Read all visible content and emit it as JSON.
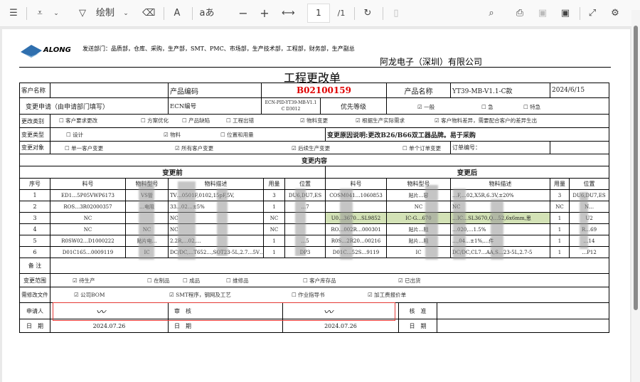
{
  "toolbar": {
    "draw_label": "绘制",
    "read_aloud": "A",
    "text_icon": "aあ",
    "zoom_out": "−",
    "zoom_in": "+",
    "page_current": "1",
    "page_total": "/1"
  },
  "doc": {
    "send_depts": "发送部门：品质部，仓库、采购，生产部，SMT、PMC、市场部，生产技术部，工程部，财务部，生产副总",
    "logo_text": "ALONG",
    "company": "阿龙电子（深圳）有限公司",
    "title": "工程更改单",
    "customer_label": "客户名称",
    "customer_value": "",
    "product_code_label": "产品编码",
    "product_code": "B02100159",
    "product_name_label": "产品名称",
    "product_name": "YT39-MB-V1.1-C款",
    "date": "2024/6/15",
    "request_label": "变更申请（由申请部门填写）",
    "ecn_label": "ECN编号",
    "ecn_value": "ECN-PID-YT39-MB-V1.1 C D3012",
    "priority_label": "优先等级",
    "priority": [
      {
        "label": "一般",
        "checked": true
      },
      {
        "label": "急",
        "checked": false
      },
      {
        "label": "特急",
        "checked": false
      }
    ],
    "change_category_label": "更改类别",
    "change_category": [
      {
        "label": "客户要求更改",
        "checked": false
      },
      {
        "label": "方案优化",
        "checked": false
      },
      {
        "label": "产品缺陷",
        "checked": false
      },
      {
        "label": "工程出错",
        "checked": false
      },
      {
        "label": "物料变更",
        "checked": true
      },
      {
        "label": "根据生产实际需求",
        "checked": true
      },
      {
        "label": "客户物料差异，需要配合客户的差异生出",
        "checked": true
      }
    ],
    "change_type_label": "变更类型",
    "change_type": [
      {
        "label": "设计",
        "checked": false
      },
      {
        "label": "物料",
        "checked": true
      },
      {
        "label": "位置和用量",
        "checked": false
      }
    ],
    "reason": "变更原因说明:更改B26/B66双工器品牌。易于采购",
    "change_target_label": "变更对象",
    "change_target": [
      {
        "label": "单一客户变更",
        "checked": false
      },
      {
        "label": "所有客户变更",
        "checked": true
      },
      {
        "label": "后续生产变更",
        "checked": true
      },
      {
        "label": "单个订单变更",
        "checked": false
      }
    ],
    "order_no_label": "订单编号：",
    "content_label": "变更内容",
    "before_label": "变更前",
    "after_label": "变更后",
    "headers_before": [
      "序号",
      "料号",
      "物料型号",
      "物料描述",
      "用量",
      "位置"
    ],
    "headers_after": [
      "料号",
      "物料型号",
      "物料描述",
      "用量",
      "位置"
    ],
    "rows": [
      {
        "no": "1",
        "b": [
          "ED1…5P05VWP6173",
          "VS管",
          "TV…0501F,0102,15pF,5V,",
          "3",
          "DU6,DU7,ES"
        ],
        "a": [
          "COSM041…1060853",
          "贴片…容",
          "…F,…02,X5R,6.3V,±20%",
          "3",
          "DU6,DU7,ES"
        ]
      },
      {
        "no": "2",
        "b": [
          "ROS…3R02000357",
          "…电阻",
          "33…02…±5%",
          "1",
          "…7"
        ],
        "a": [
          "",
          "NC",
          "NC",
          "NC",
          "N…"
        ]
      },
      {
        "no": "3",
        "b": [
          "NC",
          "",
          "NC",
          "NC",
          ""
        ],
        "a": [
          "U0…3670…SL9852",
          "IC-G…670",
          "…IC…SL3670,Q…52,6x6mm,思",
          "1",
          "U2"
        ]
      },
      {
        "no": "4",
        "b": [
          "NC",
          "NC",
          "NC",
          "NC",
          ""
        ],
        "a": [
          "RO…002R…000301",
          "贴片…阻",
          "…020,…1.5%",
          "1",
          "R…69"
        ]
      },
      {
        "no": "5",
        "b": [
          "R0SW02…D1000222",
          "贴片电…",
          "2.2R,…02,…",
          "1",
          "…5"
        ],
        "a": [
          "R0S…2R20…00216",
          "贴片…阻",
          "…,04…±1%,…件",
          "1",
          "…14"
        ]
      },
      {
        "no": "6",
        "b": [
          "D01C165…0009119",
          "IC",
          "DC/DC,…T652…,SOT23-5L,2.7…5V…芯睿",
          "1",
          "DP3"
        ],
        "a": [
          "D01C…52S…9119",
          "IC",
          "DC/DC,CL7…AA,S…23-5L,2.7-5",
          "1",
          "…P12"
        ]
      }
    ],
    "remark_label": "备 注",
    "scope_label": "变更范围",
    "scope": [
      {
        "label": "待生产",
        "checked": true
      },
      {
        "label": "在制品",
        "checked": false
      },
      {
        "label": "成品",
        "checked": false
      },
      {
        "label": "维修品",
        "checked": false
      },
      {
        "label": "客户库存品",
        "checked": false
      },
      {
        "label": "已出货",
        "checked": true
      }
    ],
    "files_label": "需修改文件",
    "files": [
      {
        "label": "公司BOM",
        "checked": true
      },
      {
        "label": "SMT程序，钢网及工艺",
        "checked": true
      },
      {
        "label": "作业指导书",
        "checked": false
      },
      {
        "label": "加工费报价单",
        "checked": true
      }
    ],
    "applicant_label": "申请人",
    "review_label": "审　核",
    "approve_label": "核　准",
    "date_label": "日　期",
    "apply_date": "2024.07.26",
    "review_date": "2024.07.26",
    "approve_date": ""
  },
  "colors": {
    "red_text": "#e00000",
    "highlight_row": "#d3e2b6",
    "annotation_box": "#e53935"
  }
}
